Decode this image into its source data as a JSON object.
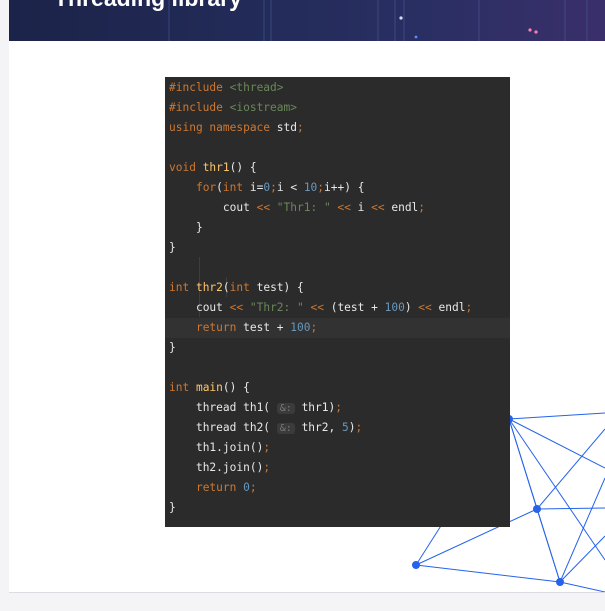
{
  "slide": {
    "title": "Threading library"
  },
  "code": [
    {
      "segments": [
        {
          "t": "#include ",
          "c": "kw"
        },
        {
          "t": "<thread>",
          "c": "str"
        }
      ]
    },
    {
      "segments": [
        {
          "t": "#include ",
          "c": "kw"
        },
        {
          "t": "<iostream>",
          "c": "str"
        }
      ]
    },
    {
      "segments": [
        {
          "t": "using namespace ",
          "c": "kw"
        },
        {
          "t": "std",
          "c": "def"
        },
        {
          "t": ";",
          "c": "kw"
        }
      ]
    },
    {
      "segments": []
    },
    {
      "segments": [
        {
          "t": "void ",
          "c": "kw"
        },
        {
          "t": "thr1",
          "c": "fn"
        },
        {
          "t": "() {",
          "c": "def"
        }
      ]
    },
    {
      "segments": [
        {
          "t": "    "
        },
        {
          "t": "for",
          "c": "kw"
        },
        {
          "t": "(",
          "c": "def"
        },
        {
          "t": "int ",
          "c": "kw"
        },
        {
          "t": "i=",
          "c": "def"
        },
        {
          "t": "0",
          "c": "num"
        },
        {
          "t": ";",
          "c": "kw"
        },
        {
          "t": "i < ",
          "c": "def"
        },
        {
          "t": "10",
          "c": "num"
        },
        {
          "t": ";",
          "c": "kw"
        },
        {
          "t": "i++) {",
          "c": "def"
        }
      ]
    },
    {
      "segments": [
        {
          "t": "        "
        },
        {
          "t": "cout ",
          "c": "def"
        },
        {
          "t": "<< ",
          "c": "kw"
        },
        {
          "t": "\"Thr1: \"",
          "c": "str"
        },
        {
          "t": " << ",
          "c": "kw"
        },
        {
          "t": "i ",
          "c": "def"
        },
        {
          "t": "<< ",
          "c": "kw"
        },
        {
          "t": "endl",
          "c": "def"
        },
        {
          "t": ";",
          "c": "kw"
        }
      ]
    },
    {
      "segments": [
        {
          "t": "    }",
          "c": "def"
        }
      ]
    },
    {
      "segments": [
        {
          "t": "}",
          "c": "def"
        }
      ]
    },
    {
      "segments": []
    },
    {
      "segments": [
        {
          "t": "int ",
          "c": "kw"
        },
        {
          "t": "thr2",
          "c": "fn"
        },
        {
          "t": "(",
          "c": "def"
        },
        {
          "t": "int ",
          "c": "kw"
        },
        {
          "t": "test) {",
          "c": "def"
        }
      ]
    },
    {
      "segments": [
        {
          "t": "    "
        },
        {
          "t": "cout ",
          "c": "def"
        },
        {
          "t": "<< ",
          "c": "kw"
        },
        {
          "t": "\"Thr2: \"",
          "c": "str"
        },
        {
          "t": " << ",
          "c": "kw"
        },
        {
          "t": "(test + ",
          "c": "def"
        },
        {
          "t": "100",
          "c": "num"
        },
        {
          "t": ") ",
          "c": "def"
        },
        {
          "t": "<< ",
          "c": "kw"
        },
        {
          "t": "endl",
          "c": "def"
        },
        {
          "t": ";",
          "c": "kw"
        }
      ]
    },
    {
      "segments": [
        {
          "t": "    "
        },
        {
          "t": "return ",
          "c": "kw"
        },
        {
          "t": "test + ",
          "c": "def"
        },
        {
          "t": "100",
          "c": "num"
        },
        {
          "t": ";",
          "c": "kw"
        }
      ],
      "highlighted": true
    },
    {
      "segments": [
        {
          "t": "}",
          "c": "def"
        }
      ]
    },
    {
      "segments": []
    },
    {
      "segments": [
        {
          "t": "int ",
          "c": "kw"
        },
        {
          "t": "main",
          "c": "fn"
        },
        {
          "t": "() {",
          "c": "def"
        }
      ]
    },
    {
      "segments": [
        {
          "t": "    "
        },
        {
          "t": "thread th1( ",
          "c": "def"
        },
        {
          "t": "&:",
          "c": "hint"
        },
        {
          "t": " thr1)",
          "c": "def"
        },
        {
          "t": ";",
          "c": "kw"
        }
      ]
    },
    {
      "segments": [
        {
          "t": "    "
        },
        {
          "t": "thread th2( ",
          "c": "def"
        },
        {
          "t": "&:",
          "c": "hint"
        },
        {
          "t": " thr2, ",
          "c": "def"
        },
        {
          "t": "5",
          "c": "num"
        },
        {
          "t": ")",
          "c": "def"
        },
        {
          "t": ";",
          "c": "kw"
        }
      ]
    },
    {
      "segments": [
        {
          "t": "    "
        },
        {
          "t": "th1.join()",
          "c": "def"
        },
        {
          "t": ";",
          "c": "kw"
        }
      ]
    },
    {
      "segments": [
        {
          "t": "    "
        },
        {
          "t": "th2.join()",
          "c": "def"
        },
        {
          "t": ";",
          "c": "kw"
        }
      ]
    },
    {
      "segments": [
        {
          "t": "    "
        },
        {
          "t": "return ",
          "c": "kw"
        },
        {
          "t": "0",
          "c": "num"
        },
        {
          "t": ";",
          "c": "kw"
        }
      ]
    },
    {
      "segments": [
        {
          "t": "}",
          "c": "def"
        }
      ]
    }
  ],
  "colors": {
    "banner": "#1c2349",
    "editor_bg": "#2b2b2b",
    "network_blue": "#2563eb"
  }
}
